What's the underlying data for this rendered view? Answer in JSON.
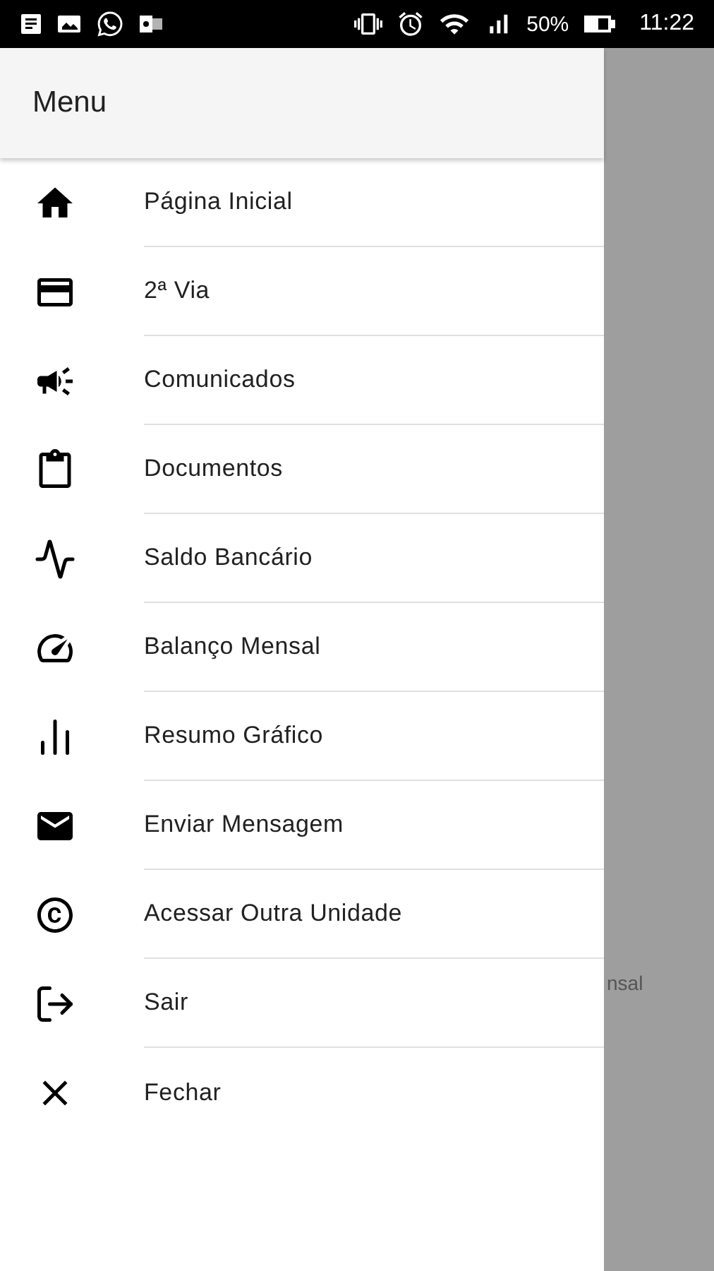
{
  "status_bar": {
    "battery": "50%",
    "time": "11:22"
  },
  "drawer": {
    "title": "Menu",
    "items": [
      {
        "label": "Página Inicial"
      },
      {
        "label": "2ª Via"
      },
      {
        "label": "Comunicados"
      },
      {
        "label": "Documentos"
      },
      {
        "label": "Saldo Bancário"
      },
      {
        "label": "Balanço Mensal"
      },
      {
        "label": "Resumo Gráfico"
      },
      {
        "label": "Enviar Mensagem"
      },
      {
        "label": "Acessar Outra Unidade"
      },
      {
        "label": "Sair"
      },
      {
        "label": "Fechar"
      }
    ]
  },
  "background": {
    "visible_text": "nsal"
  }
}
